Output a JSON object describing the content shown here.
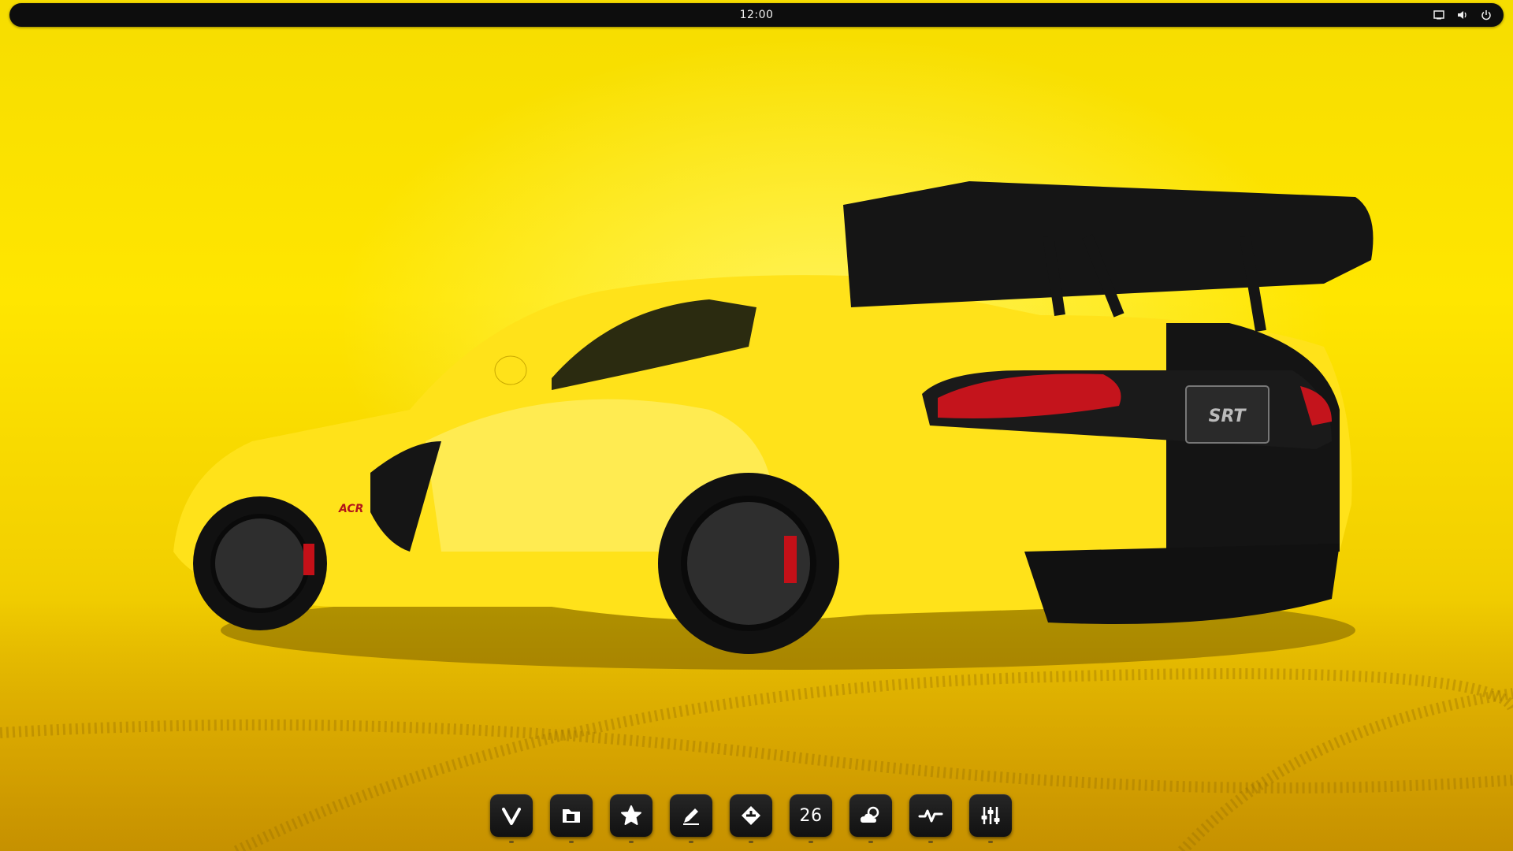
{
  "top_panel": {
    "clock": "12:00",
    "tray": [
      {
        "icon": "display-icon"
      },
      {
        "icon": "volume-icon"
      },
      {
        "icon": "power-icon"
      }
    ]
  },
  "wallpaper": {
    "description_colors": {
      "background": "#f6dd00",
      "car_body": "#ffe21a",
      "stripe": "#141414"
    },
    "badge_text": "SRT",
    "side_badge_text": "ACR"
  },
  "dock": {
    "items": [
      {
        "icon": "vivaldi-browser-icon"
      },
      {
        "icon": "files-icon"
      },
      {
        "icon": "favorites-star-icon"
      },
      {
        "icon": "text-editor-icon"
      },
      {
        "icon": "app-center-icon"
      },
      {
        "icon": "calendar-icon",
        "label": "26"
      },
      {
        "icon": "weather-icon"
      },
      {
        "icon": "system-monitor-icon"
      },
      {
        "icon": "settings-mixer-icon"
      }
    ]
  }
}
